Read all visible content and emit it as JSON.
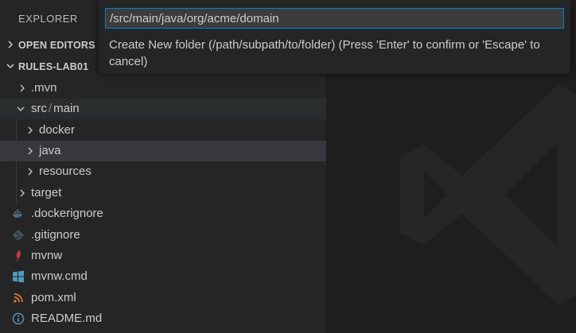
{
  "explorer": {
    "title": "EXPLORER"
  },
  "sections": {
    "open_editors": "OPEN EDITORS",
    "project": "RULES-LAB01"
  },
  "tree": {
    "mvn": ".mvn",
    "src_main_part1": "src",
    "src_main_sep": "/",
    "src_main_part2": "main",
    "docker": "docker",
    "java": "java",
    "resources": "resources",
    "target": "target",
    "dockerignore": ".dockerignore",
    "gitignore": ".gitignore",
    "mvnw": "mvnw",
    "mvnw_cmd": "mvnw.cmd",
    "pom": "pom.xml",
    "readme": "README.md"
  },
  "icons": {
    "dockerignore": "docker-icon",
    "gitignore": "git-icon",
    "mvnw": "maven-feather-icon",
    "mvnw_cmd": "windows-icon",
    "pom": "rss-xml-icon",
    "readme": "info-icon"
  },
  "quick_input": {
    "value": "/src/main/java/org/acme/domain",
    "message": "Create New folder (/path/subpath/to/folder) (Press 'Enter' to confirm or 'Escape' to cancel)"
  },
  "colors": {
    "accent": "#007fd4",
    "sidebar": "#252526",
    "editor": "#1e1e1e",
    "selection": "#37373d"
  }
}
